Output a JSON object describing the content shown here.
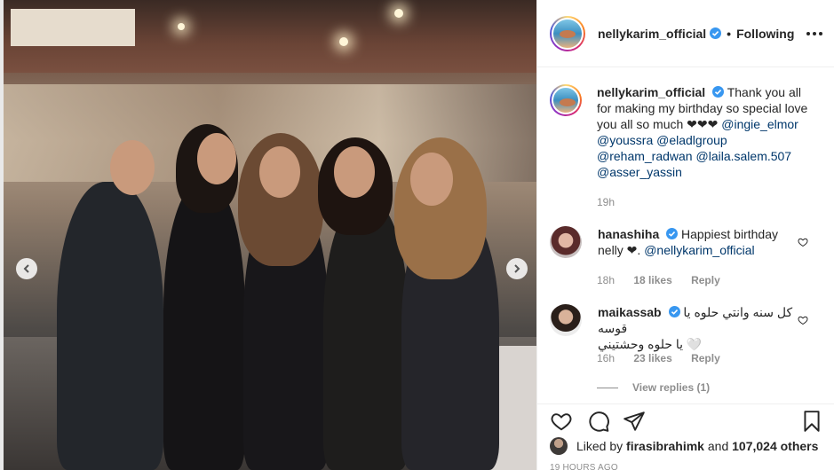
{
  "post": {
    "nav": {
      "prev_icon": "chevron-left-icon",
      "next_icon": "chevron-right-icon"
    }
  },
  "header": {
    "username": "nellykarim_official",
    "separator": "•",
    "follow_status": "Following"
  },
  "caption": {
    "username": "nellykarim_official",
    "text": "Thank you all for making my birthday so special love you all so much ❤❤❤",
    "mentions": [
      "@ingie_elmor",
      "@youssra",
      "@eladlgroup",
      "@reham_radwan",
      "@laila.salem.507",
      "@asser_yassin"
    ],
    "time": "19h"
  },
  "comments": [
    {
      "username": "hanashiha",
      "text": "Happiest birthday nelly ❤.",
      "mention": "@nellykarim_official",
      "time": "18h",
      "likes": "18 likes",
      "reply": "Reply"
    },
    {
      "username": "maikassab",
      "text_line1": "كل سنه وانتي حلوه يا قوسه",
      "text_line2": "🤍 يا حلوه وحشتيني",
      "time": "16h",
      "likes": "23 likes",
      "reply": "Reply",
      "view_replies": "View replies (1)"
    }
  ],
  "likes": {
    "prefix": "Liked by",
    "user": "firasibrahimk",
    "middle": "and",
    "count": "107,024 others"
  },
  "footer_time": "19 HOURS AGO",
  "colors": {
    "link": "#00376b",
    "muted": "#8e8e8e",
    "text": "#262626",
    "verified": "#3897f0"
  }
}
